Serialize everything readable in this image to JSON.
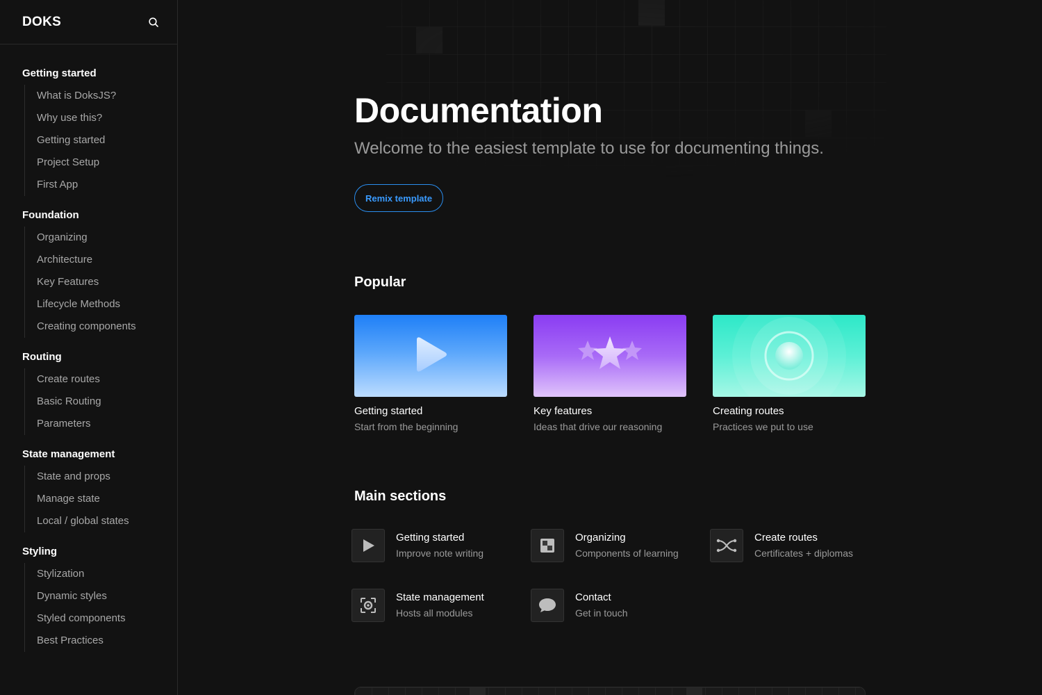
{
  "sidebar": {
    "logo": "DOKS",
    "search_icon": "search-icon",
    "groups": [
      {
        "title": "Getting started",
        "items": [
          "What is DoksJS?",
          "Why use this?",
          "Getting started",
          "Project Setup",
          "First App"
        ]
      },
      {
        "title": "Foundation",
        "items": [
          "Organizing",
          "Architecture",
          "Key Features",
          "Lifecycle Methods",
          "Creating components"
        ]
      },
      {
        "title": "Routing",
        "items": [
          "Create routes",
          "Basic Routing",
          "Parameters"
        ]
      },
      {
        "title": "State management",
        "items": [
          "State and props",
          "Manage state",
          "Local / global states"
        ]
      },
      {
        "title": "Styling",
        "items": [
          "Stylization",
          "Dynamic styles",
          "Styled components",
          "Best Practices"
        ]
      }
    ]
  },
  "hero": {
    "title": "Documentation",
    "subtitle": "Welcome to the easiest template to use for documenting things.",
    "button_label": "Remix template"
  },
  "popular": {
    "title": "Popular",
    "cards": [
      {
        "title": "Getting started",
        "description": "Start from the beginning",
        "icon": "play-icon"
      },
      {
        "title": "Key features",
        "description": "Ideas that drive our reasoning",
        "icon": "star-icon"
      },
      {
        "title": "Creating routes",
        "description": "Practices we put to use",
        "icon": "orb-icon"
      }
    ]
  },
  "main_sections": {
    "title": "Main sections",
    "items": [
      {
        "label": "Getting started",
        "description": "Improve note writing",
        "icon": "play-icon"
      },
      {
        "label": "Organizing",
        "description": "Components of learning",
        "icon": "layout-icon"
      },
      {
        "label": "Create routes",
        "description": "Certificates + diplomas",
        "icon": "shuffle-icon"
      },
      {
        "label": "State management",
        "description": "Hosts all modules",
        "icon": "focus-icon"
      },
      {
        "label": "Contact",
        "description": "Get in touch",
        "icon": "chat-icon"
      }
    ]
  },
  "colors": {
    "background": "#121212",
    "accent": "#2a8ef0",
    "muted_text": "#9a9a9a"
  }
}
